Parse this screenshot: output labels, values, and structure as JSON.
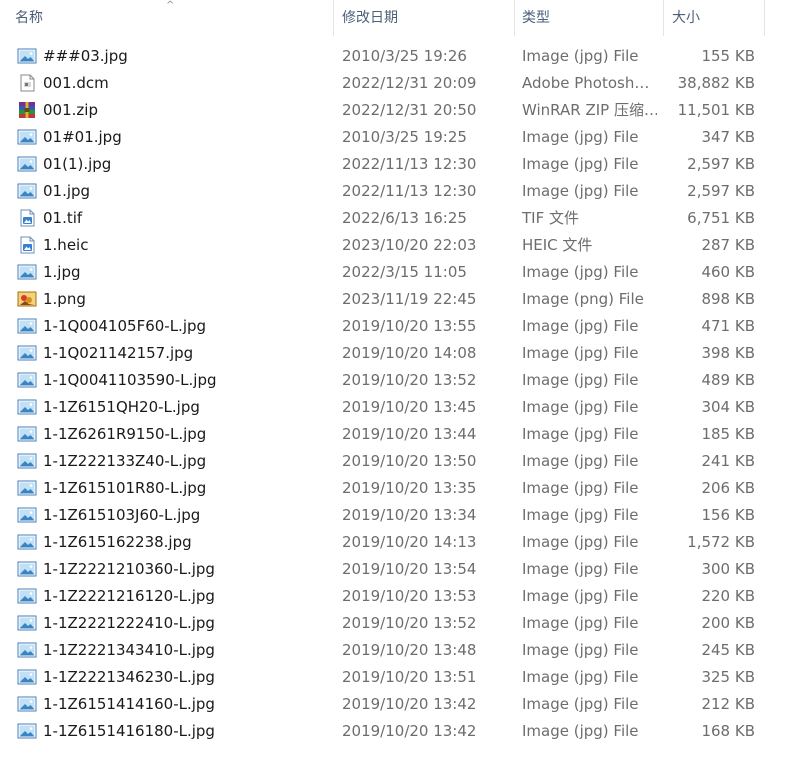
{
  "header": {
    "col_name": "名称",
    "col_date": "修改日期",
    "col_type": "类型",
    "col_size": "大小",
    "sort_indicator": "^"
  },
  "files": [
    {
      "icon": "image-file-icon",
      "name": "###03.jpg",
      "date": "2010/3/25 19:26",
      "type": "Image (jpg) File",
      "size": "155 KB"
    },
    {
      "icon": "generic-file-icon",
      "name": "001.dcm",
      "date": "2022/12/31 20:09",
      "type": "Adobe Photosh…",
      "size": "38,882 KB"
    },
    {
      "icon": "winrar-archive-icon",
      "name": "001.zip",
      "date": "2022/12/31 20:50",
      "type": "WinRAR ZIP 压缩…",
      "size": "11,501 KB"
    },
    {
      "icon": "image-file-icon",
      "name": "01#01.jpg",
      "date": "2010/3/25 19:25",
      "type": "Image (jpg) File",
      "size": "347 KB"
    },
    {
      "icon": "image-file-icon",
      "name": "01(1).jpg",
      "date": "2022/11/13 12:30",
      "type": "Image (jpg) File",
      "size": "2,597 KB"
    },
    {
      "icon": "image-file-icon",
      "name": "01.jpg",
      "date": "2022/11/13 12:30",
      "type": "Image (jpg) File",
      "size": "2,597 KB"
    },
    {
      "icon": "tif-file-icon",
      "name": "01.tif",
      "date": "2022/6/13 16:25",
      "type": "TIF 文件",
      "size": "6,751 KB"
    },
    {
      "icon": "heic-file-icon",
      "name": "1.heic",
      "date": "2023/10/20 22:03",
      "type": "HEIC 文件",
      "size": "287 KB"
    },
    {
      "icon": "image-file-icon",
      "name": "1.jpg",
      "date": "2022/3/15 11:05",
      "type": "Image (jpg) File",
      "size": "460 KB"
    },
    {
      "icon": "png-file-icon",
      "name": "1.png",
      "date": "2023/11/19 22:45",
      "type": "Image (png) File",
      "size": "898 KB"
    },
    {
      "icon": "image-file-icon",
      "name": "1-1Q004105F60-L.jpg",
      "date": "2019/10/20 13:55",
      "type": "Image (jpg) File",
      "size": "471 KB"
    },
    {
      "icon": "image-file-icon",
      "name": "1-1Q021142157.jpg",
      "date": "2019/10/20 14:08",
      "type": "Image (jpg) File",
      "size": "398 KB"
    },
    {
      "icon": "image-file-icon",
      "name": "1-1Q0041103590-L.jpg",
      "date": "2019/10/20 13:52",
      "type": "Image (jpg) File",
      "size": "489 KB"
    },
    {
      "icon": "image-file-icon",
      "name": "1-1Z6151QH20-L.jpg",
      "date": "2019/10/20 13:45",
      "type": "Image (jpg) File",
      "size": "304 KB"
    },
    {
      "icon": "image-file-icon",
      "name": "1-1Z6261R9150-L.jpg",
      "date": "2019/10/20 13:44",
      "type": "Image (jpg) File",
      "size": "185 KB"
    },
    {
      "icon": "image-file-icon",
      "name": "1-1Z222133Z40-L.jpg",
      "date": "2019/10/20 13:50",
      "type": "Image (jpg) File",
      "size": "241 KB"
    },
    {
      "icon": "image-file-icon",
      "name": "1-1Z615101R80-L.jpg",
      "date": "2019/10/20 13:35",
      "type": "Image (jpg) File",
      "size": "206 KB"
    },
    {
      "icon": "image-file-icon",
      "name": "1-1Z615103J60-L.jpg",
      "date": "2019/10/20 13:34",
      "type": "Image (jpg) File",
      "size": "156 KB"
    },
    {
      "icon": "image-file-icon",
      "name": "1-1Z615162238.jpg",
      "date": "2019/10/20 14:13",
      "type": "Image (jpg) File",
      "size": "1,572 KB"
    },
    {
      "icon": "image-file-icon",
      "name": "1-1Z2221210360-L.jpg",
      "date": "2019/10/20 13:54",
      "type": "Image (jpg) File",
      "size": "300 KB"
    },
    {
      "icon": "image-file-icon",
      "name": "1-1Z2221216120-L.jpg",
      "date": "2019/10/20 13:53",
      "type": "Image (jpg) File",
      "size": "220 KB"
    },
    {
      "icon": "image-file-icon",
      "name": "1-1Z2221222410-L.jpg",
      "date": "2019/10/20 13:52",
      "type": "Image (jpg) File",
      "size": "200 KB"
    },
    {
      "icon": "image-file-icon",
      "name": "1-1Z2221343410-L.jpg",
      "date": "2019/10/20 13:48",
      "type": "Image (jpg) File",
      "size": "245 KB"
    },
    {
      "icon": "image-file-icon",
      "name": "1-1Z2221346230-L.jpg",
      "date": "2019/10/20 13:51",
      "type": "Image (jpg) File",
      "size": "325 KB"
    },
    {
      "icon": "image-file-icon",
      "name": "1-1Z6151414160-L.jpg",
      "date": "2019/10/20 13:42",
      "type": "Image (jpg) File",
      "size": "212 KB"
    },
    {
      "icon": "image-file-icon",
      "name": "1-1Z6151416180-L.jpg",
      "date": "2019/10/20 13:42",
      "type": "Image (jpg) File",
      "size": "168 KB"
    }
  ]
}
